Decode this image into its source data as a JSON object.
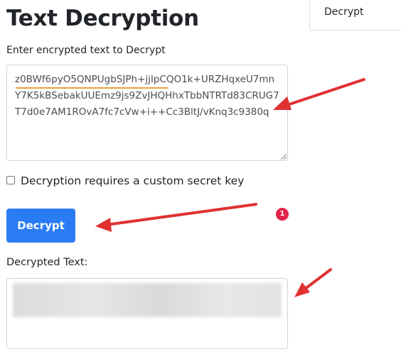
{
  "page": {
    "title": "Text Decryption"
  },
  "tab": {
    "label": "Decrypt"
  },
  "input": {
    "label": "Enter encrypted text to Decrypt",
    "value": "z0BWf6pyO5QNPUgbSJPh+jjIpCQO1k+URZHqxeU7mnY7K5kBSebakUUEmz9js9ZvJHQHhxTbbNTRTd83CRUG7T7d0e7AM1ROvA7fc7cVw+i++Cc3BltJ/vKnq3c9380q",
    "badge_count": "1"
  },
  "checkbox": {
    "label": "Decryption requires a custom secret key",
    "checked": false
  },
  "button": {
    "label": "Decrypt"
  },
  "output": {
    "label": "Decrypted Text:"
  },
  "colors": {
    "primary_button": "#2a7cf4",
    "annotation_arrow": "#e03131",
    "badge": "#e5234a",
    "spellcheck_underline": "#e8a037"
  }
}
